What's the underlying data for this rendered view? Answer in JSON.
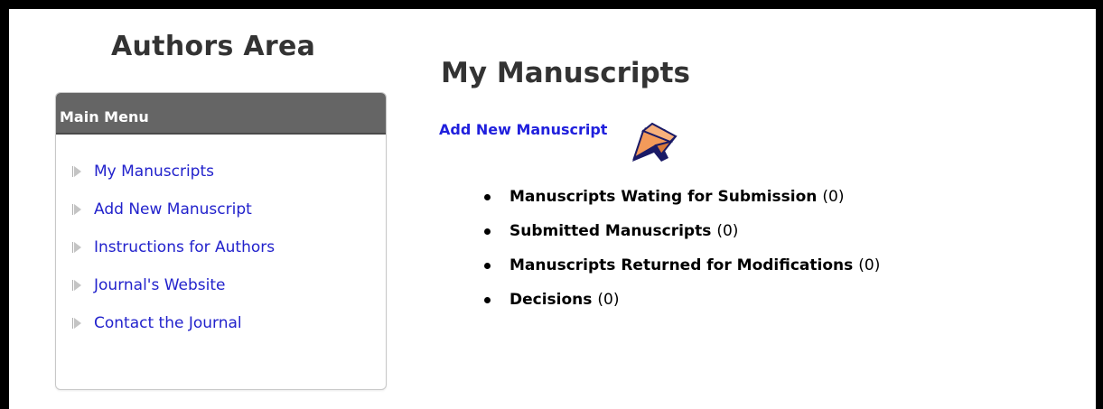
{
  "sidebar": {
    "title": "Authors Area",
    "menu_header": "Main Menu",
    "items": [
      {
        "label": "My Manuscripts"
      },
      {
        "label": "Add New Manuscript"
      },
      {
        "label": "Instructions for Authors"
      },
      {
        "label": "Journal's Website"
      },
      {
        "label": "Contact the Journal"
      }
    ]
  },
  "main": {
    "title": "My Manuscripts",
    "add_link": "Add New Manuscript",
    "status_items": [
      {
        "name": "Manuscripts Wating for Submission",
        "count": "(0)"
      },
      {
        "name": "Submitted Manuscripts",
        "count": "(0)"
      },
      {
        "name": "Manuscripts Returned for Modifications",
        "count": "(0)"
      },
      {
        "name": "Decisions",
        "count": "(0)"
      }
    ]
  },
  "colors": {
    "menu_header_bg": "#656565",
    "link": "#2020dd",
    "cursor_fill": "#f39a5a",
    "cursor_outline": "#1a1a66"
  },
  "icons": {
    "menu_bullet": "triangle-bullet-icon",
    "cursor": "pointer-cursor-icon"
  }
}
